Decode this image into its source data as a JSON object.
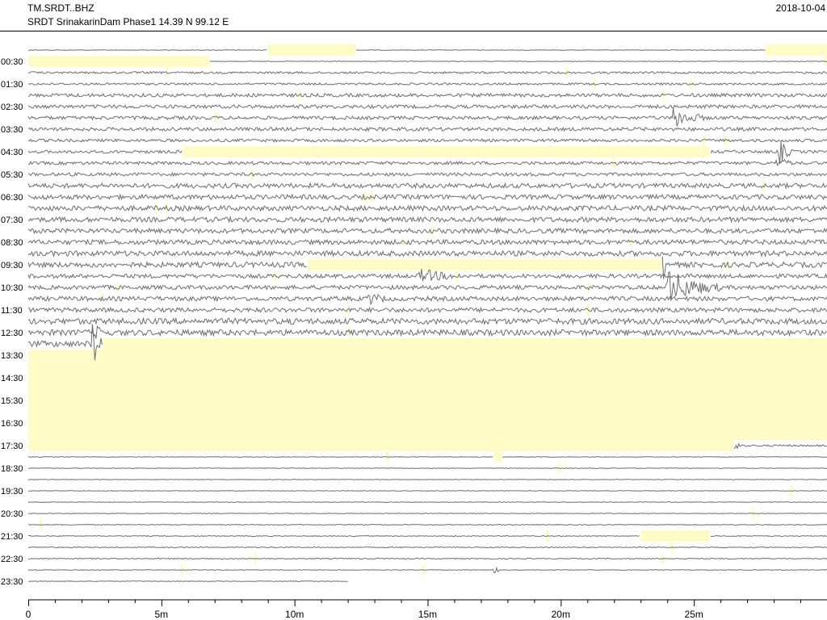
{
  "header": {
    "channel": "TM.SRDT..BHZ",
    "station_info": "SRDT SrinakarinDam Phase1  14.39 N 99.12 E",
    "date": "2018-10-04"
  },
  "colors": {
    "trace": "#6e6e6e",
    "gap": "#fffbc6",
    "axis": "#000000",
    "background": "#ffffff"
  },
  "chart_data": {
    "type": "helicorder",
    "title": "TM.SRDT..BHZ",
    "subtitle": "SRDT SrinakarinDam Phase1  14.39 N 99.12 E",
    "date": "2018-10-04",
    "xlabel": "",
    "ylabel": "",
    "x_unit": "minutes",
    "xlim": [
      0,
      30
    ],
    "x_ticks": [
      {
        "value": 0,
        "label": "0"
      },
      {
        "value": 5,
        "label": "5m"
      },
      {
        "value": 10,
        "label": "10m"
      },
      {
        "value": 15,
        "label": "15m"
      },
      {
        "value": 20,
        "label": "20m"
      },
      {
        "value": 25,
        "label": "25m"
      }
    ],
    "minor_tick_every_minutes": 1,
    "hour_labels": [
      "00:30",
      "01:30",
      "02:30",
      "03:30",
      "04:30",
      "05:30",
      "06:30",
      "07:30",
      "08:30",
      "09:30",
      "10:30",
      "11:30",
      "12:30",
      "13:30",
      "14:30",
      "15:30",
      "16:30",
      "17:30",
      "18:30",
      "19:30",
      "20:30",
      "21:30",
      "22:30",
      "23:30"
    ],
    "line_minutes": 30,
    "first_line_time": "00:00",
    "trace_lines": 48,
    "data_ends_at": "23:42",
    "gaps": [
      {
        "start": "00:09",
        "end": "00:12.3"
      },
      {
        "start": "00:27.7",
        "end": "00:30"
      },
      {
        "start": "00:30",
        "end": "00:36.8"
      },
      {
        "start": "04:35.8",
        "end": "04:55.6"
      },
      {
        "start": "09:40.5",
        "end": "09:53.8"
      },
      {
        "start": "13:02.8",
        "end": "13:10.5"
      },
      {
        "start": "13:10.5",
        "end": "17:56.5"
      },
      {
        "start": "18:17.5",
        "end": "18:17.8"
      },
      {
        "start": "21:53",
        "end": "21:55.6"
      }
    ],
    "events": [
      {
        "time": "03:24.2",
        "amplitude": 2.2,
        "duration_minutes": 1.2
      },
      {
        "time": "04:58.2",
        "amplitude": 3.0,
        "duration_minutes": 0.5
      },
      {
        "time": "05:28.1",
        "amplitude": 1.2,
        "duration_minutes": 0.6
      },
      {
        "time": "09:53.8",
        "amplitude": 4.0,
        "duration_minutes": 0.3
      },
      {
        "time": "10:14.7",
        "amplitude": 1.4,
        "duration_minutes": 1.5
      },
      {
        "time": "10:54.0",
        "amplitude": 3.5,
        "duration_minutes": 2.0
      },
      {
        "time": "11:12.8",
        "amplitude": 1.4,
        "duration_minutes": 0.6
      },
      {
        "time": "12:32.5",
        "amplitude": 1.2,
        "duration_minutes": 0.5
      },
      {
        "time": "13:02.4",
        "amplitude": 5.0,
        "duration_minutes": 0.5
      },
      {
        "time": "17:56.5",
        "amplitude": 2.5,
        "duration_minutes": 0.2
      },
      {
        "time": "23:17.5",
        "amplitude": 1.3,
        "duration_minutes": 0.2
      }
    ],
    "noise_by_hour": [
      0.12,
      0.35,
      0.6,
      0.6,
      0.5,
      0.55,
      0.8,
      0.85,
      0.8,
      0.9,
      0.7,
      0.75,
      1.0,
      1.0,
      0,
      0,
      0,
      0.3,
      0.12,
      0.1,
      0.12,
      0.15,
      0.18,
      0.12
    ],
    "legend": "none",
    "grid": false
  }
}
